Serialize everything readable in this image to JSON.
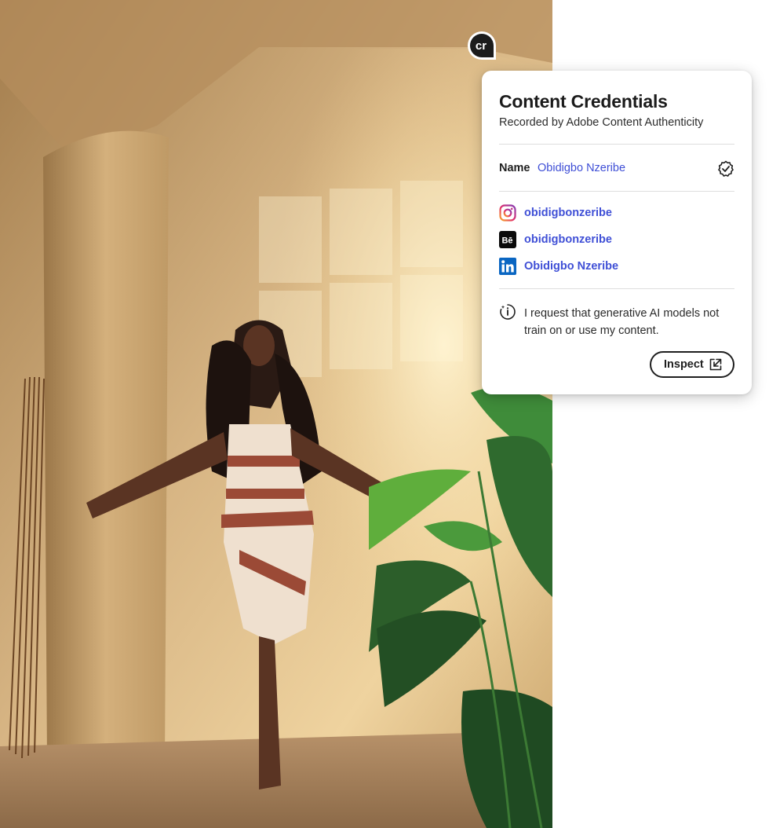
{
  "badge": {
    "text": "cr",
    "icon": "content-credentials-icon"
  },
  "panel": {
    "title": "Content Credentials",
    "subtitle": "Recorded by Adobe Content Authenticity",
    "name_label": "Name",
    "name_value": "Obidigbo Nzeribe",
    "verified_icon": "verified-badge-icon",
    "socials": [
      {
        "icon": "instagram-icon",
        "handle": "obidigbonzeribe"
      },
      {
        "icon": "behance-icon",
        "handle": "obidigbonzeribe"
      },
      {
        "icon": "linkedin-icon",
        "handle": "Obidigbo Nzeribe"
      }
    ],
    "ai_notice": "I request that generative AI models not train on or use my content.",
    "inspect_label": "Inspect"
  },
  "colors": {
    "link": "#3f4fd6",
    "text": "#1f1f1f",
    "behance": "#0b0b0b",
    "linkedin": "#0a66c2"
  }
}
